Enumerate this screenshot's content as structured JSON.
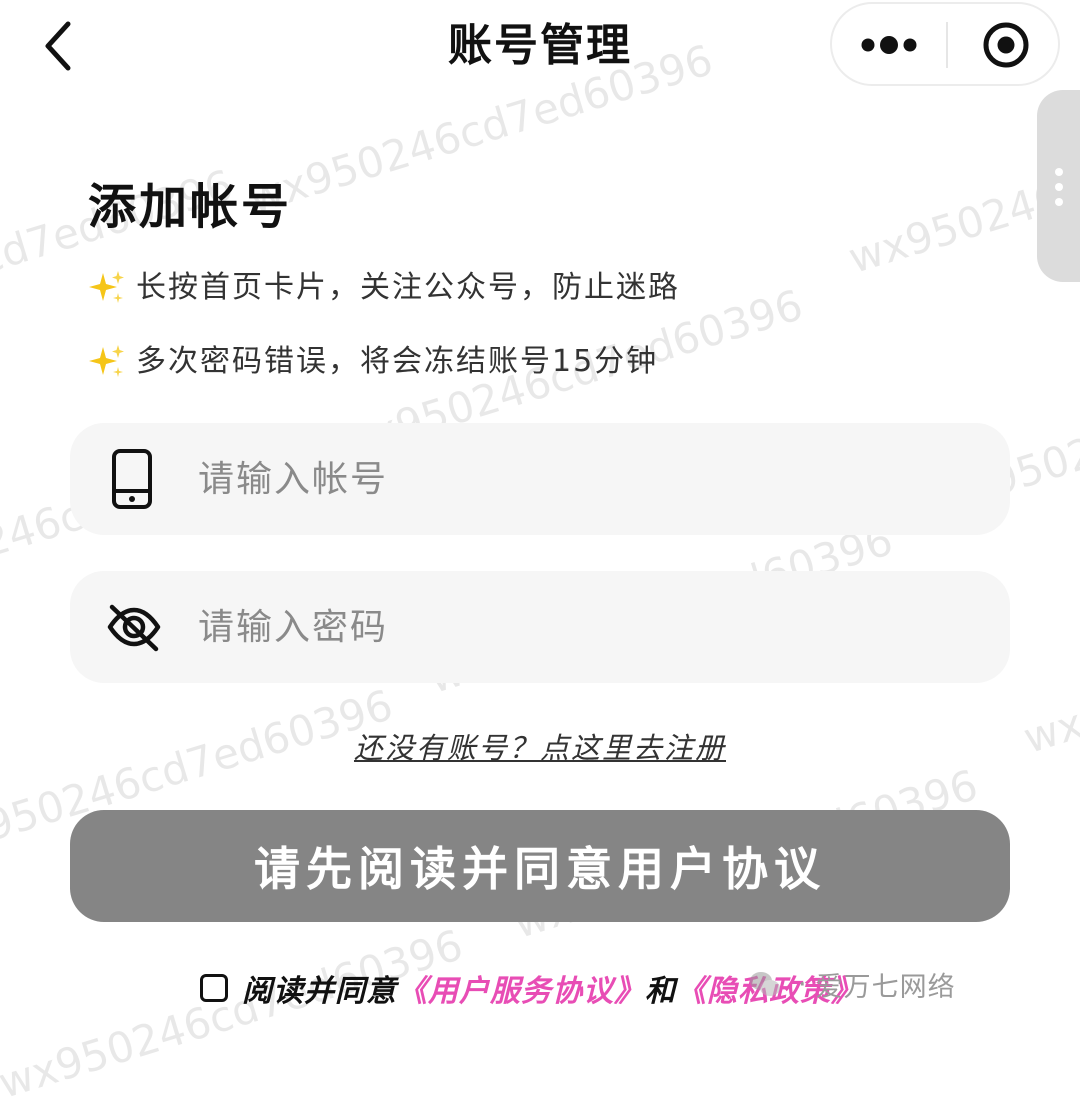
{
  "nav": {
    "title": "账号管理",
    "back_icon": "chevron-left-icon",
    "more_icon": "more-dots-icon",
    "close_icon": "target-close-icon"
  },
  "watermark": "wx950246cd7ed60396",
  "page": {
    "heading": "添加帐号",
    "tips": [
      "长按首页卡片，关注公众号，防止迷路",
      "多次密码错误，将会冻结账号15分钟"
    ]
  },
  "form": {
    "account_placeholder": "请输入帐号",
    "account_value": "",
    "password_placeholder": "请输入密码",
    "password_value": "",
    "register_link": "还没有账号？点这里去注册",
    "submit_label": "请先阅读并同意用户协议"
  },
  "agreement": {
    "checked": false,
    "prefix": "阅读并同意",
    "user_agreement": "《用户服务协议》",
    "conjunction": "和",
    "privacy_policy": "《隐私政策》"
  },
  "source_tag": {
    "label": "爱万七网络"
  },
  "colors": {
    "accent_pink": "#e84db5",
    "button_gray": "#858585",
    "field_bg": "#f6f6f6"
  }
}
